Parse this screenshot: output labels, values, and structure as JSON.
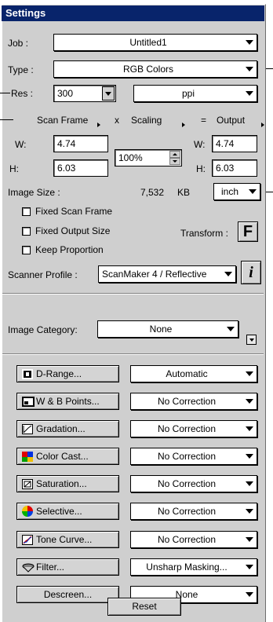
{
  "window": {
    "title": "Settings"
  },
  "job": {
    "label": "Job :",
    "value": "Untitled1"
  },
  "type": {
    "label": "Type :",
    "value": "RGB Colors"
  },
  "resolution": {
    "label": "Res :",
    "value": "300",
    "unit": "ppi"
  },
  "scan_frame": {
    "header_scan": "Scan Frame",
    "header_x": "x",
    "header_scaling": "Scaling",
    "header_eq": "=",
    "header_output": "Output",
    "w_label": "W:",
    "h_label": "H:",
    "scan_w": "4.74",
    "scan_h": "6.03",
    "scaling": "100%",
    "out_w_label": "W:",
    "out_h_label": "H:",
    "out_w": "4.74",
    "out_h": "6.03"
  },
  "image_size": {
    "label": "Image Size :",
    "value": "7,532",
    "unit": "KB",
    "units_select": "inch"
  },
  "options": {
    "fixed_scan_frame": "Fixed Scan Frame",
    "fixed_output_size": "Fixed Output Size",
    "keep_proportion": "Keep Proportion",
    "transform_label": "Transform :",
    "transform_icon_text": "F"
  },
  "scanner_profile": {
    "label": "Scanner Profile :",
    "value": "ScanMaker 4 / Reflective",
    "info_icon_text": "i"
  },
  "image_category": {
    "label": "Image Category:",
    "value": "None"
  },
  "adjustments": [
    {
      "button": "D-Range...",
      "icon": "d-range-icon",
      "value": "Automatic"
    },
    {
      "button": "W & B Points...",
      "icon": "wb-points-icon",
      "value": "No Correction"
    },
    {
      "button": "Gradation...",
      "icon": "gradation-icon",
      "value": "No Correction"
    },
    {
      "button": "Color Cast...",
      "icon": "color-cast-icon",
      "value": "No Correction"
    },
    {
      "button": "Saturation...",
      "icon": "saturation-icon",
      "value": "No Correction"
    },
    {
      "button": "Selective...",
      "icon": "selective-icon",
      "value": "No Correction"
    },
    {
      "button": "Tone Curve...",
      "icon": "tone-curve-icon",
      "value": "No Correction"
    },
    {
      "button": "Filter...",
      "icon": "filter-icon",
      "value": "Unsharp Masking..."
    },
    {
      "button": "Descreen...",
      "icon": "",
      "value": "None"
    }
  ],
  "reset": {
    "label": "Reset"
  },
  "colors": {
    "titlebar": "#08246b",
    "panel": "#cfcfcf"
  }
}
